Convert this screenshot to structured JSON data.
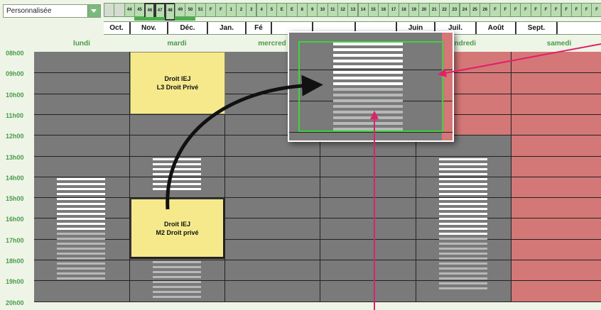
{
  "dropdown": {
    "value": "Personnalisée"
  },
  "weeks": [
    {
      "label": "",
      "style": "gray"
    },
    {
      "label": "",
      "style": "gray"
    },
    {
      "label": "44",
      "style": "normal"
    },
    {
      "label": "45",
      "style": "normal"
    },
    {
      "label": "46",
      "style": "tall"
    },
    {
      "label": "47",
      "style": "tall"
    },
    {
      "label": "48",
      "style": "tall"
    },
    {
      "label": "49",
      "style": "normal"
    },
    {
      "label": "50",
      "style": "normal"
    },
    {
      "label": "51",
      "style": "normal"
    },
    {
      "label": "F",
      "style": "normal"
    },
    {
      "label": "F",
      "style": "normal"
    },
    {
      "label": "1",
      "style": "normal"
    },
    {
      "label": "2",
      "style": "normal"
    },
    {
      "label": "3",
      "style": "normal"
    },
    {
      "label": "4",
      "style": "normal"
    },
    {
      "label": "5",
      "style": "normal"
    },
    {
      "label": "E",
      "style": "normal"
    },
    {
      "label": "E",
      "style": "normal"
    },
    {
      "label": "8",
      "style": "normal"
    },
    {
      "label": "9",
      "style": "normal"
    },
    {
      "label": "10",
      "style": "normal"
    },
    {
      "label": "11",
      "style": "normal"
    },
    {
      "label": "12",
      "style": "normal"
    },
    {
      "label": "13",
      "style": "normal"
    },
    {
      "label": "14",
      "style": "normal"
    },
    {
      "label": "15",
      "style": "normal"
    },
    {
      "label": "16",
      "style": "normal"
    },
    {
      "label": "17",
      "style": "normal"
    },
    {
      "label": "18",
      "style": "normal"
    },
    {
      "label": "19",
      "style": "normal"
    },
    {
      "label": "20",
      "style": "normal"
    },
    {
      "label": "21",
      "style": "normal"
    },
    {
      "label": "22",
      "style": "normal"
    },
    {
      "label": "23",
      "style": "normal"
    },
    {
      "label": "24",
      "style": "normal"
    },
    {
      "label": "25",
      "style": "normal"
    },
    {
      "label": "26",
      "style": "normal"
    },
    {
      "label": "F",
      "style": "normal"
    },
    {
      "label": "F",
      "style": "normal"
    },
    {
      "label": "F",
      "style": "normal"
    },
    {
      "label": "F",
      "style": "normal"
    },
    {
      "label": "F",
      "style": "normal"
    },
    {
      "label": "F",
      "style": "normal"
    },
    {
      "label": "F",
      "style": "normal"
    },
    {
      "label": "F",
      "style": "normal"
    },
    {
      "label": "F",
      "style": "normal"
    },
    {
      "label": "F",
      "style": "normal"
    },
    {
      "label": "F",
      "style": "normal"
    }
  ],
  "months": [
    "Oct.",
    "Nov.",
    "Déc.",
    "Jan.",
    "Fé",
    "",
    "",
    "",
    "Juin",
    "Juil.",
    "Août",
    "Sept."
  ],
  "days": [
    "lundi",
    "mardi",
    "mercred",
    "",
    "endredi",
    "samedi"
  ],
  "hours": [
    "08h00",
    "09h00",
    "10h00",
    "11h00",
    "12h00",
    "13h00",
    "14h00",
    "15h00",
    "16h00",
    "17h00",
    "18h00",
    "19h00",
    "20h00"
  ],
  "events": [
    {
      "line1": "Droit IEJ",
      "line2": "L3 Droit Privé"
    },
    {
      "line1": "Droit IEJ",
      "line2": "M2 Droit privé"
    }
  ],
  "colors": {
    "grid": "#7a7a7a",
    "pink": "#d47777",
    "event": "#f5e98c",
    "accent": "#4a9a4a",
    "arrow": "#e0206a",
    "zoom_border": "#3dd43d"
  }
}
